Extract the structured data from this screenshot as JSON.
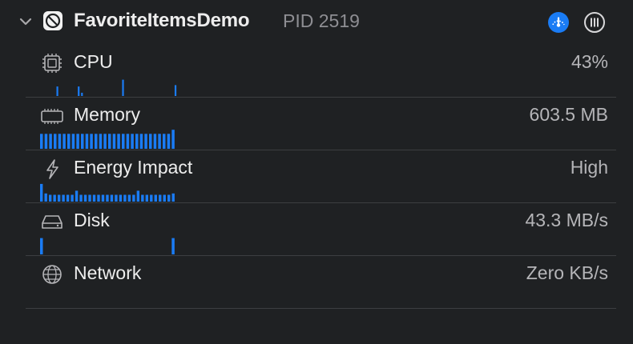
{
  "process": {
    "name": "FavoriteItemsDemo",
    "pid": "PID 2519"
  },
  "colors": {
    "accent": "#1a7cf5",
    "background": "#1f2123",
    "divider": "#3c3e41"
  },
  "metrics": [
    {
      "id": "cpu",
      "label": "CPU",
      "value": "43%",
      "icon": "cpu-chip-icon",
      "bars": [
        0,
        0,
        0,
        0,
        0,
        0,
        0,
        0,
        0,
        0,
        0.35,
        0,
        0,
        0,
        0,
        0,
        0,
        0,
        0,
        0,
        0,
        0,
        0,
        0.35,
        0,
        0.12,
        0,
        0,
        0,
        0,
        0,
        0,
        0,
        0,
        0,
        0,
        0,
        0,
        0,
        0,
        0,
        0,
        0,
        0,
        0,
        0,
        0,
        0,
        0,
        0,
        0.6,
        0,
        0,
        0,
        0,
        0,
        0,
        0,
        0,
        0,
        0,
        0,
        0,
        0,
        0,
        0,
        0,
        0,
        0,
        0,
        0,
        0,
        0,
        0,
        0,
        0,
        0,
        0,
        0,
        0,
        0,
        0,
        0.4
      ]
    },
    {
      "id": "memory",
      "label": "Memory",
      "value": "603.5 MB",
      "icon": "memory-icon",
      "bars": [
        0.55,
        0.55,
        0.55,
        0.55,
        0.55,
        0.55,
        0.55,
        0.55,
        0.55,
        0.55,
        0.55,
        0.55,
        0.55,
        0.55,
        0.55,
        0.55,
        0.55,
        0.55,
        0.55,
        0.55,
        0.55,
        0.55,
        0.55,
        0.55,
        0.55,
        0.55,
        0.55,
        0.55,
        0.55,
        0.7
      ]
    },
    {
      "id": "energy",
      "label": "Energy Impact",
      "value": "High",
      "icon": "lightning-bolt-icon",
      "bars": [
        0.65,
        0.3,
        0.25,
        0.25,
        0.25,
        0.25,
        0.25,
        0.25,
        0.4,
        0.25,
        0.25,
        0.25,
        0.25,
        0.25,
        0.25,
        0.25,
        0.25,
        0.25,
        0.25,
        0.25,
        0.25,
        0.25,
        0.4,
        0.25,
        0.25,
        0.25,
        0.25,
        0.25,
        0.25,
        0.25,
        0.3
      ]
    },
    {
      "id": "disk",
      "label": "Disk",
      "value": "43.3 MB/s",
      "icon": "disk-drive-icon",
      "bars": [
        0.6,
        0,
        0,
        0,
        0,
        0,
        0,
        0,
        0,
        0,
        0,
        0,
        0,
        0,
        0,
        0,
        0,
        0,
        0,
        0,
        0,
        0,
        0,
        0,
        0,
        0,
        0,
        0,
        0,
        0.6
      ]
    },
    {
      "id": "network",
      "label": "Network",
      "value": "Zero KB/s",
      "icon": "globe-icon",
      "bars": []
    }
  ]
}
